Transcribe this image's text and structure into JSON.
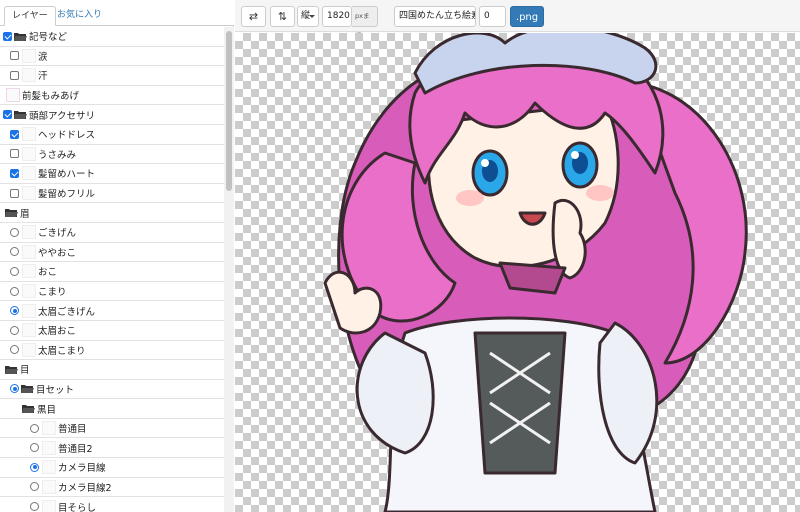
{
  "tabs": [
    {
      "label": "レイヤー",
      "active": true
    },
    {
      "label": "お気に入り",
      "active": false
    }
  ],
  "layers": [
    {
      "label": "記号など",
      "control": "checkbox",
      "checked": true,
      "folder": true,
      "indent": 0
    },
    {
      "label": "涙",
      "control": "checkbox",
      "checked": false,
      "folder": false,
      "indent": 1
    },
    {
      "label": "汗",
      "control": "checkbox",
      "checked": false,
      "folder": false,
      "indent": 1
    },
    {
      "label": "前髪もみあげ",
      "control": "none",
      "checked": false,
      "folder": false,
      "indent": 0
    },
    {
      "label": "頭部アクセサリ",
      "control": "checkbox",
      "checked": true,
      "folder": true,
      "indent": 0
    },
    {
      "label": "ヘッドドレス",
      "control": "checkbox",
      "checked": true,
      "folder": false,
      "indent": 1
    },
    {
      "label": "うさみみ",
      "control": "checkbox",
      "checked": false,
      "folder": false,
      "indent": 1
    },
    {
      "label": "髪留めハート",
      "control": "checkbox",
      "checked": true,
      "folder": false,
      "indent": 1
    },
    {
      "label": "髪留めフリル",
      "control": "checkbox",
      "checked": false,
      "folder": false,
      "indent": 1
    },
    {
      "label": "眉",
      "control": "none",
      "checked": false,
      "folder": true,
      "indent": 0
    },
    {
      "label": "ごきげん",
      "control": "radio",
      "checked": false,
      "folder": false,
      "indent": 1
    },
    {
      "label": "ややおこ",
      "control": "radio",
      "checked": false,
      "folder": false,
      "indent": 1
    },
    {
      "label": "おこ",
      "control": "radio",
      "checked": false,
      "folder": false,
      "indent": 1
    },
    {
      "label": "こまり",
      "control": "radio",
      "checked": false,
      "folder": false,
      "indent": 1
    },
    {
      "label": "太眉ごきげん",
      "control": "radio",
      "checked": true,
      "folder": false,
      "indent": 1
    },
    {
      "label": "太眉おこ",
      "control": "radio",
      "checked": false,
      "folder": false,
      "indent": 1
    },
    {
      "label": "太眉こまり",
      "control": "radio",
      "checked": false,
      "folder": false,
      "indent": 1
    },
    {
      "label": "目",
      "control": "none",
      "checked": false,
      "folder": true,
      "indent": 0
    },
    {
      "label": "目セット",
      "control": "radio",
      "checked": true,
      "folder": true,
      "indent": 1
    },
    {
      "label": "黒目",
      "control": "none",
      "checked": false,
      "folder": true,
      "indent": 2
    },
    {
      "label": "普通目",
      "control": "radio",
      "checked": false,
      "folder": false,
      "indent": 3
    },
    {
      "label": "普通目2",
      "control": "radio",
      "checked": false,
      "folder": false,
      "indent": 3
    },
    {
      "label": "カメラ目線",
      "control": "radio",
      "checked": true,
      "folder": false,
      "indent": 3
    },
    {
      "label": "カメラ目線2",
      "control": "radio",
      "checked": false,
      "folder": false,
      "indent": 3
    },
    {
      "label": "目そらし",
      "control": "radio",
      "checked": false,
      "folder": false,
      "indent": 3
    }
  ],
  "toolbar": {
    "swap_label": "⇄",
    "sort_label": "⇅",
    "orientation": "縦",
    "size_value": "1820",
    "size_unit": "pxまで",
    "filename": "四国めたん立ち絵素材",
    "index_value": "0",
    "export_label": ".png"
  },
  "colors": {
    "accent": "#337ab7",
    "checkbox": "#1a73e8",
    "hair": "#e96fc9",
    "eye": "#2aa7e8"
  }
}
